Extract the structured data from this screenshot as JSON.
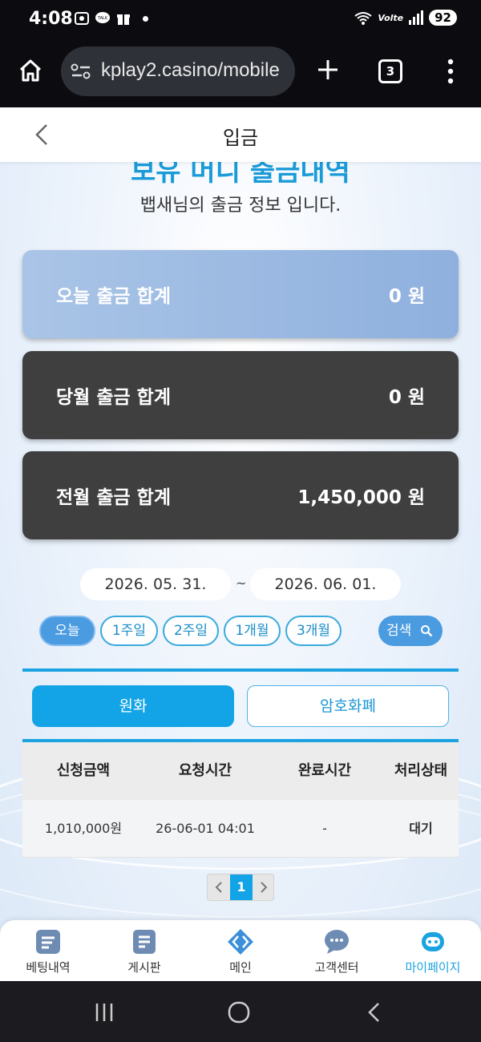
{
  "status": {
    "time": "4:08",
    "volte": "Volte",
    "battery": "92"
  },
  "browser": {
    "url": "kplay2.casino/mobile",
    "tab_count": "3"
  },
  "header": {
    "title": "입금"
  },
  "page": {
    "section_title": "보유 머니 출금내역",
    "subtitle": "뱁새님의 출금 정보 입니다."
  },
  "summary": [
    {
      "label": "오늘 출금 합계",
      "value": "0 원"
    },
    {
      "label": "당월 출금 합계",
      "value": "0 원"
    },
    {
      "label": "전월 출금 합계",
      "value": "1,450,000 원"
    }
  ],
  "date_range": {
    "start": "2026. 05. 31.",
    "separator": "~",
    "end": "2026. 06. 01."
  },
  "periods": [
    "오늘",
    "1주일",
    "2주일",
    "1개월",
    "3개월"
  ],
  "search_label": "검색",
  "tabs": {
    "won": "원화",
    "crypto": "암호화폐"
  },
  "table": {
    "headers": [
      "신청금액",
      "요청시간",
      "완료시간",
      "처리상태"
    ],
    "rows": [
      [
        "1,010,000원",
        "26-06-01 04:01",
        "-",
        "대기"
      ]
    ]
  },
  "pagination": {
    "current": "1"
  },
  "bottom_nav": [
    {
      "label": "베팅내역",
      "icon": "betting-history-icon"
    },
    {
      "label": "게시판",
      "icon": "board-icon"
    },
    {
      "label": "메인",
      "icon": "main-diamond-icon"
    },
    {
      "label": "고객센터",
      "icon": "chat-bubble-icon"
    },
    {
      "label": "마이페이지",
      "icon": "robot-face-icon",
      "active": true
    }
  ],
  "colors": {
    "accent": "#12a4e6",
    "dark_card": "#3f3f3f",
    "light_card": "#9bb9e2"
  }
}
